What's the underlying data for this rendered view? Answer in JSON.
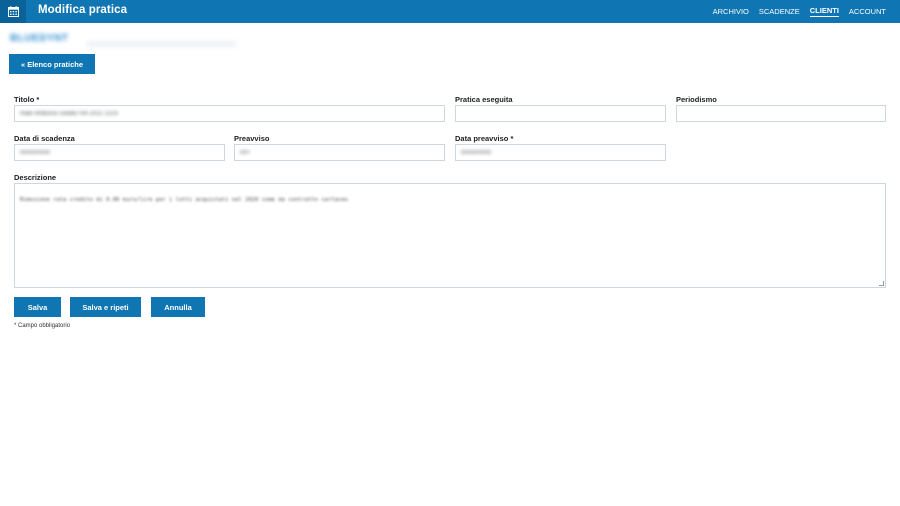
{
  "header": {
    "title": "Modifica pratica",
    "logo_icon": "calendar-icon",
    "nav": [
      "ARCHIVIO",
      "SCADENZE",
      "CLIENTI",
      "ACCOUNT"
    ],
    "active_nav": "CLIENTI",
    "bar_color": "#0f76b3"
  },
  "client": {
    "name": "BLUEDYNT"
  },
  "back_button": "« Elenco pratiche",
  "form": {
    "titolo": {
      "label": "Titolo *",
      "value": "Rate rimborso credito IVA 2021 1/2/3"
    },
    "pratica_eseguita": {
      "label": "Pratica eseguita",
      "value": ""
    },
    "periodismo": {
      "label": "Periodismo",
      "value": ""
    },
    "data_scadenza": {
      "label": "Data di scadenza",
      "value": "00/00/0000"
    },
    "preavviso": {
      "label": "Preavviso",
      "value": "00+"
    },
    "data_preavviso": {
      "label": "Data preavviso *",
      "value": "00/00/0000"
    },
    "descrizione": {
      "label": "Descrizione",
      "value": "Rimozione rata credito di 0.00 euro/lire per i lotti acquistati nel 2020 come da contratto cartaceo"
    }
  },
  "buttons": {
    "save": "Salva",
    "save_repeat": "Salva e ripeti",
    "cancel": "Annulla"
  },
  "note": "* Campo obbligatorio"
}
